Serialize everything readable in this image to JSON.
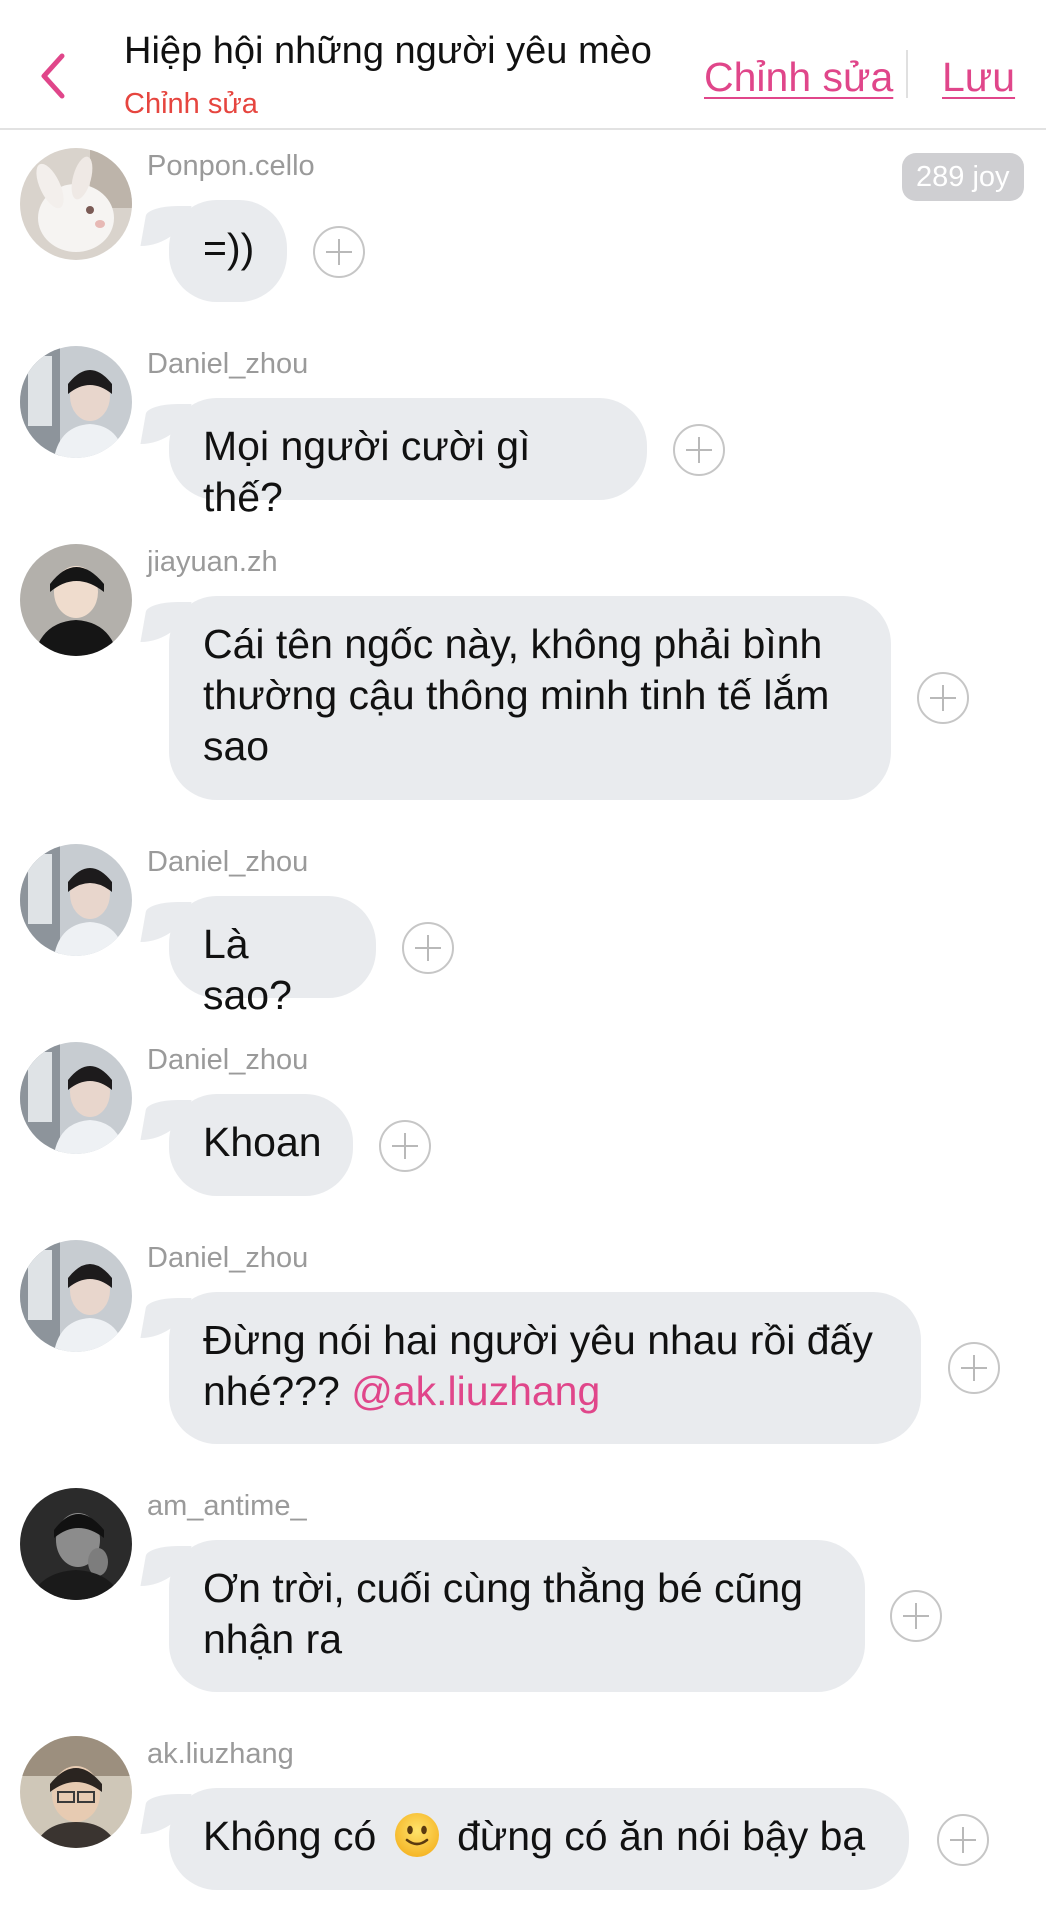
{
  "header": {
    "title": "Hiệp hội những người yêu mèo",
    "subtitle": "Chỉnh sửa",
    "edit_label": "Chỉnh sửa",
    "save_label": "Lưu",
    "accent_color": "#e0468a"
  },
  "messages": [
    {
      "user": "Ponpon.cello",
      "avatar": "white-rabbit-avatar",
      "text": "=))",
      "badge": "289 joy"
    },
    {
      "user": "Daniel_zhou",
      "avatar": "profile-photo-avatar",
      "text": "Mọi người cười gì thế?"
    },
    {
      "user": "jiayuan.zh",
      "avatar": "profile-photo-avatar",
      "text": "Cái tên ngốc này, không phải bình thường cậu thông minh tinh tế lắm sao"
    },
    {
      "user": "Daniel_zhou",
      "avatar": "profile-photo-avatar",
      "text": "Là sao?"
    },
    {
      "user": "Daniel_zhou",
      "avatar": "profile-photo-avatar",
      "text": "Khoan"
    },
    {
      "user": "Daniel_zhou",
      "avatar": "profile-photo-avatar",
      "text": "Đừng nói hai người yêu nhau rồi đấy nhé???",
      "mention": "@ak.liuzhang"
    },
    {
      "user": "am_antime_",
      "avatar": "profile-photo-avatar",
      "text": "Ơn trời, cuối cùng thằng bé cũng nhận ra"
    },
    {
      "user": "ak.liuzhang",
      "avatar": "profile-photo-avatar",
      "text_before": "Không có",
      "emoji": "slightly-smiling-face-emoji",
      "text_after": "đừng có ăn nói bậy bạ"
    }
  ]
}
